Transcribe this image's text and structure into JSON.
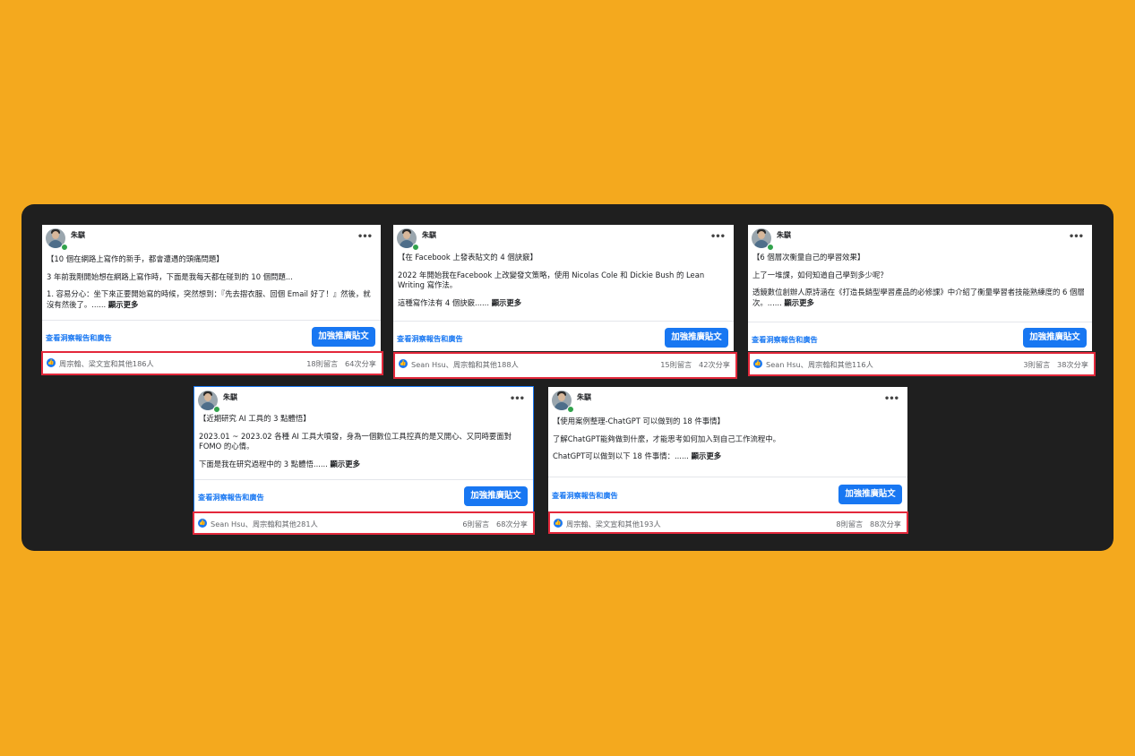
{
  "posts": [
    {
      "author": "朱騏",
      "lines": [
        "【10 個在網路上寫作的新手，都會遭遇的頭痛問題】",
        "3 年前我剛開始想在網路上寫作時，下面是我每天都在碰到的 10 個問題...",
        "1. 容易分心：坐下來正要開始寫的時候，突然想到：『先去摺衣服、回個 Email 好了！』然後，就沒有然後了。......"
      ],
      "see_more": "顯示更多",
      "insights_label": "查看洞察報告和廣告",
      "boost_label": "加強推廣貼文",
      "reactors": "周宗翰、梁文宣和其他186人",
      "comments": "18則留言",
      "shares": "64次分享"
    },
    {
      "author": "朱騏",
      "lines": [
        "【在 Facebook 上發表貼文的 4 個訣竅】",
        "2022 年開始我在Facebook 上改變發文策略，使用 Nicolas Cole 和 Dickie Bush 的 Lean Writing 寫作法。",
        "這種寫作法有 4 個訣竅......"
      ],
      "see_more": "顯示更多",
      "insights_label": "查看洞察報告和廣告",
      "boost_label": "加強推廣貼文",
      "reactors": "Sean Hsu、周宗翰和其他188人",
      "comments": "15則留言",
      "shares": "42次分享"
    },
    {
      "author": "朱騏",
      "lines": [
        "【6 個層次衡量自己的學習效果】",
        "上了一堆課，如何知道自己學到多少呢？",
        "透鏡數位創辦人原詩涵在《打造長銷型學習產品的必修課》中介紹了衡量學習者技能熟練度的 6 個層次。......"
      ],
      "see_more": "顯示更多",
      "insights_label": "查看洞察報告和廣告",
      "boost_label": "加強推廣貼文",
      "reactors": "Sean Hsu、周宗翰和其他116人",
      "comments": "3則留言",
      "shares": "38次分享"
    },
    {
      "author": "朱騏",
      "lines": [
        "【近期研究 AI 工具的 3 點體悟】",
        "2023.01 ~ 2023.02 各種 AI 工具大噴發，身為一個數位工具控真的是又開心、又同時要面對 FOMO 的心情。",
        "下面是我在研究過程中的 3 點體悟......"
      ],
      "see_more": "顯示更多",
      "insights_label": "查看洞察報告和廣告",
      "boost_label": "加強推廣貼文",
      "reactors": "Sean Hsu、周宗翰和其他281人",
      "comments": "6則留言",
      "shares": "68次分享"
    },
    {
      "author": "朱騏",
      "lines": [
        "【使用案例整理-ChatGPT 可以做到的 18 件事情】",
        "了解ChatGPT能夠做到什麼，才能思考如何加入到自己工作流程中。",
        "ChatGPT可以做到以下 18 件事情：......"
      ],
      "see_more": "顯示更多",
      "insights_label": "查看洞察報告和廣告",
      "boost_label": "加強推廣貼文",
      "reactors": "周宗翰、梁文宣和其他193人",
      "comments": "8則留言",
      "shares": "88次分享"
    }
  ],
  "colors": {
    "background": "#F4A91E",
    "panel": "#1f1f1f",
    "accent": "#1877F2",
    "highlight": "#e3283b"
  },
  "icons": {
    "like": "thumbs-up-icon",
    "more": "more-options-icon"
  }
}
